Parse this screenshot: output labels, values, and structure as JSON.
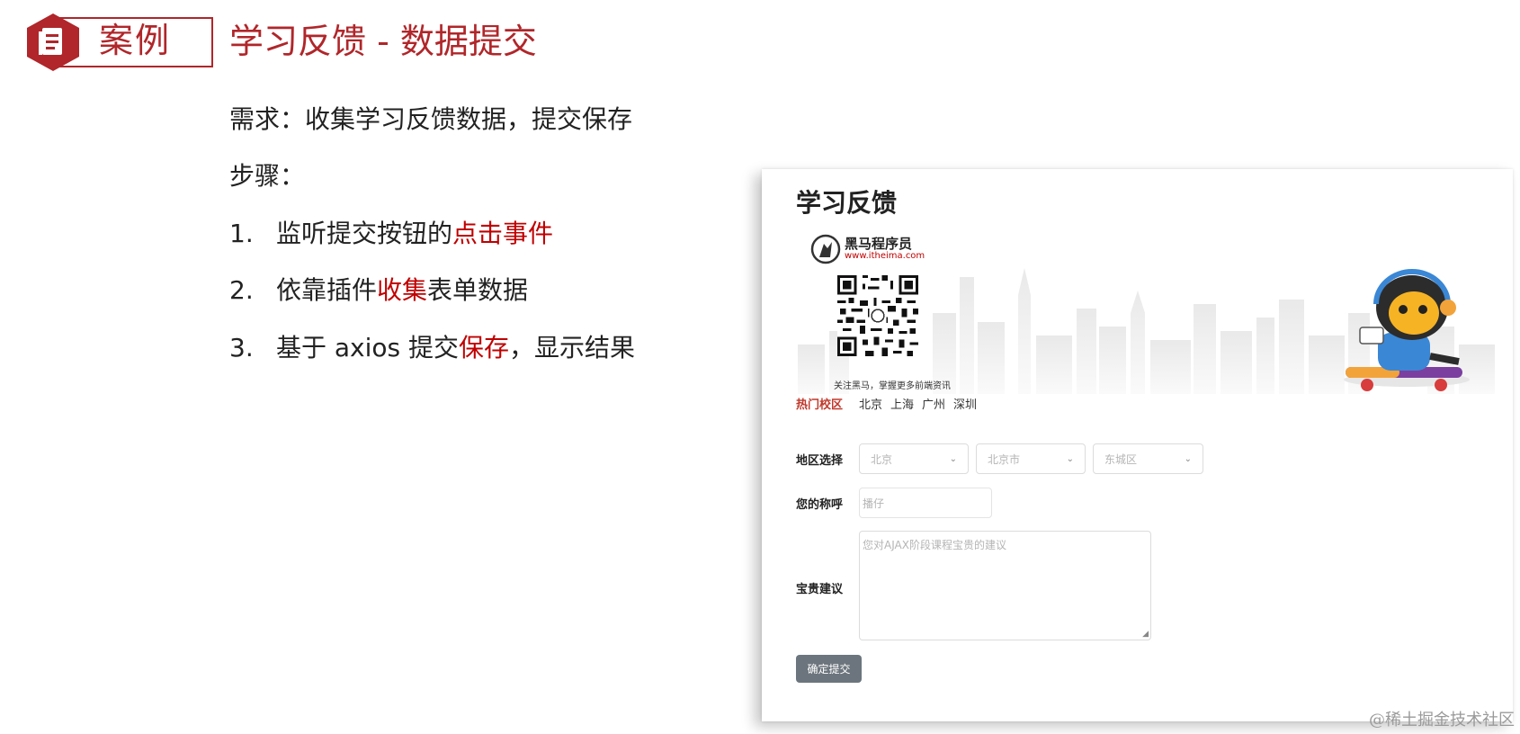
{
  "header": {
    "badge_label": "案例",
    "badge_icon": "document-icon",
    "title": "学习反馈 - 数据提交"
  },
  "content": {
    "requirement": "需求：收集学习反馈数据，提交保存",
    "steps_heading": "步骤：",
    "steps": [
      {
        "num": "1.",
        "pre": "监听提交按钮的",
        "hl": "点击事件",
        "post": ""
      },
      {
        "num": "2.",
        "pre": "依靠插件",
        "hl": "收集",
        "post": "表单数据"
      },
      {
        "num": "3.",
        "pre": "基于 axios 提交",
        "hl": "保存",
        "post": "，显示结果"
      }
    ]
  },
  "screenshot": {
    "title": "学习反馈",
    "logo_name": "黑马程序员",
    "logo_url": "www.itheima.com",
    "qr_caption": "关注黑马，掌握更多前端资讯",
    "hot_campus_label": "热门校区",
    "campuses": [
      "北京",
      "上海",
      "广州",
      "深圳"
    ],
    "region_label": "地区选择",
    "province_value": "北京",
    "city_value": "北京市",
    "district_value": "东城区",
    "name_label": "您的称呼",
    "name_placeholder": "播仔",
    "advice_label": "宝贵建议",
    "advice_placeholder": "您对AJAX阶段课程宝贵的建议",
    "submit_label": "确定提交"
  },
  "watermark": "@稀土掘金技术社区",
  "colors": {
    "accent": "#b0262a",
    "highlight": "#c00000",
    "button": "#6c757d"
  }
}
